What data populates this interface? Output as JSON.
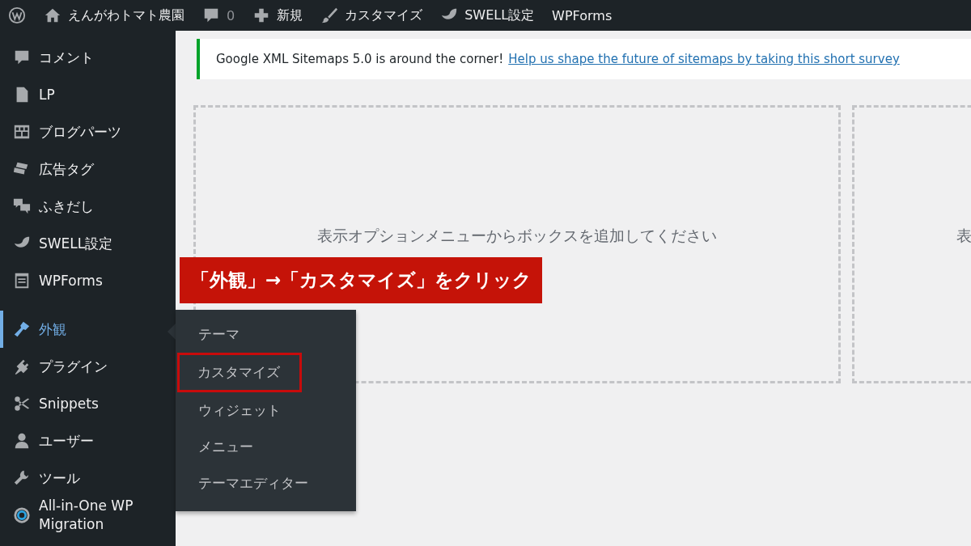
{
  "topbar": {
    "site_name": "えんがわトマト農園",
    "comments_count": "0",
    "new_label": "新規",
    "customize_label": "カスタマイズ",
    "swell_label": "SWELL設定",
    "wpforms_label": "WPForms"
  },
  "sidebar": {
    "items": [
      {
        "label": "コメント",
        "selected": false
      },
      {
        "label": "LP",
        "selected": false
      },
      {
        "label": "ブログパーツ",
        "selected": false
      },
      {
        "label": "広告タグ",
        "selected": false
      },
      {
        "label": "ふきだし",
        "selected": false
      },
      {
        "label": "SWELL設定",
        "selected": false
      },
      {
        "label": "WPForms",
        "selected": false
      },
      {
        "label": "外観",
        "selected": true
      },
      {
        "label": "プラグイン",
        "selected": false
      },
      {
        "label": "Snippets",
        "selected": false
      },
      {
        "label": "ユーザー",
        "selected": false
      },
      {
        "label": "ツール",
        "selected": false
      },
      {
        "label": "All-in-One WP Migration",
        "selected": false
      }
    ]
  },
  "flyout": {
    "items": [
      {
        "label": "テーマ",
        "boxed": false
      },
      {
        "label": "カスタマイズ",
        "boxed": true
      },
      {
        "label": "ウィジェット",
        "boxed": false
      },
      {
        "label": "メニュー",
        "boxed": false
      },
      {
        "label": "テーマエディター",
        "boxed": false
      }
    ]
  },
  "notice": {
    "text": "Google XML Sitemaps 5.0 is around the corner!",
    "link": "Help us shape the future of sitemaps by taking this short survey"
  },
  "boxes": [
    {
      "text": "表示オプションメニューからボックスを追加してください"
    },
    {
      "text": "表"
    }
  ],
  "callout": {
    "text": "「外観」→「カスタマイズ」をクリック"
  }
}
